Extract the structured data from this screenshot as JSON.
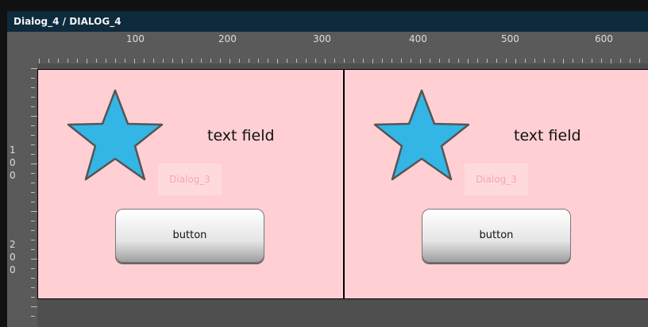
{
  "window": {
    "title": "Dialog_4 / DIALOG_4"
  },
  "ruler_top": {
    "labels": [
      "100",
      "200",
      "300",
      "400",
      "500",
      "600"
    ]
  },
  "ruler_left": {
    "labels": [
      "1",
      "0",
      "0",
      "2",
      "0",
      "0"
    ]
  },
  "dialogs": [
    {
      "text_field": "text field",
      "name_label": "Dialog_3",
      "button_label": "button"
    },
    {
      "text_field": "text field",
      "name_label": "Dialog_3",
      "button_label": "button"
    }
  ],
  "colors": {
    "dialog_bg": "#ffcfd3",
    "star_fill": "#33b6e6",
    "title_bar": "#0e2a3d"
  },
  "icons": [
    "star-icon"
  ]
}
